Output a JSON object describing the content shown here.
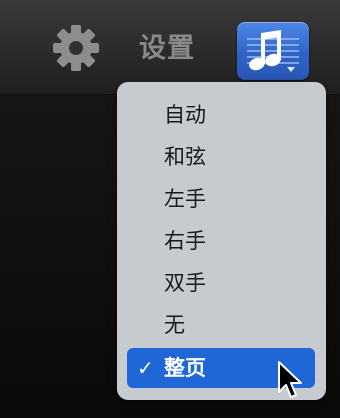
{
  "toolbar": {
    "settings_label": "设置",
    "settings_icon": "gear-icon",
    "score_icon": "music-note-score-icon",
    "accent_color": "#2f63c9"
  },
  "menu": {
    "items": [
      {
        "label": "自动",
        "selected": false
      },
      {
        "label": "和弦",
        "selected": false
      },
      {
        "label": "左手",
        "selected": false
      },
      {
        "label": "右手",
        "selected": false
      },
      {
        "label": "双手",
        "selected": false
      },
      {
        "label": "无",
        "selected": false
      },
      {
        "label": "整页",
        "selected": true
      }
    ],
    "check_glyph": "✓",
    "selection_color": "#1f66d6"
  }
}
